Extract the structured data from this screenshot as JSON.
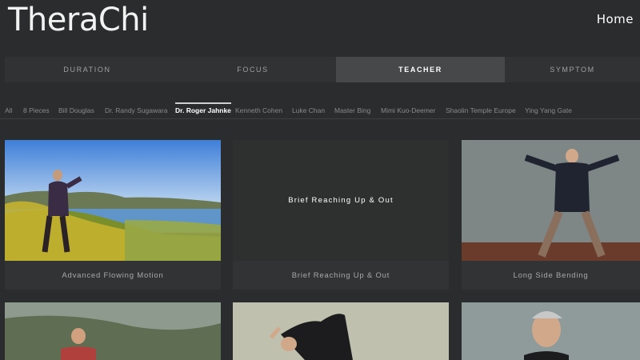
{
  "header": {
    "logo": "TheraChi",
    "home_label": "Home"
  },
  "tabs": [
    {
      "label": "DURATION",
      "active": false
    },
    {
      "label": "FOCUS",
      "active": false
    },
    {
      "label": "TEACHER",
      "active": true
    },
    {
      "label": "SYMPTOM",
      "active": false
    }
  ],
  "filters": [
    "All",
    "8 Pieces",
    "Bill Douglas",
    "Dr. Randy Sugawara",
    "Dr. Roger Jahnke",
    "Kenneth Cohen",
    "Luke Chan",
    "Master Bing",
    "Mimi Kuo-Deemer",
    "Shaolin Temple Europe",
    "Ying Yang Gate"
  ],
  "active_filter": "Dr. Roger Jahnke",
  "cards": [
    {
      "title": "Advanced Flowing Motion"
    },
    {
      "title": "Brief Reaching Up & Out",
      "overlay": "Brief Reaching Up & Out"
    },
    {
      "title": "Long Side Bending"
    }
  ]
}
